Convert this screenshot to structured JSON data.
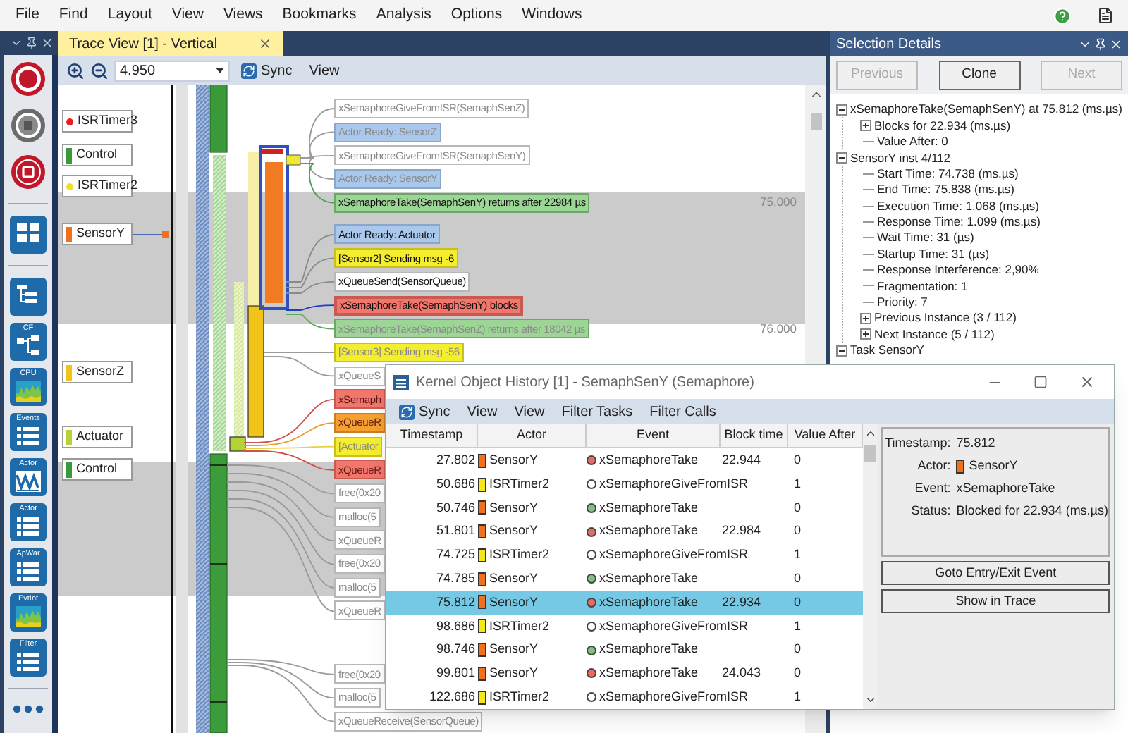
{
  "menu": [
    "File",
    "Find",
    "Layout",
    "View",
    "Views",
    "Bookmarks",
    "Analysis",
    "Options",
    "Windows"
  ],
  "tools": [
    {
      "kind": "record"
    },
    {
      "kind": "stop"
    },
    {
      "kind": "snapshot"
    },
    {
      "kind": "separator"
    },
    {
      "kind": "grid"
    },
    {
      "kind": "separator"
    },
    {
      "kind": "tree"
    },
    {
      "kind": "flow",
      "label": "CF"
    },
    {
      "kind": "chart",
      "label": "CPU"
    },
    {
      "kind": "list",
      "label": "Events"
    },
    {
      "kind": "wave",
      "label": "Actor"
    },
    {
      "kind": "list",
      "label": "Actor"
    },
    {
      "kind": "list",
      "label": "ApWar"
    },
    {
      "kind": "chart",
      "label": "EvtInt"
    },
    {
      "kind": "list",
      "label": "Filter"
    },
    {
      "kind": "separator"
    },
    {
      "kind": "more"
    }
  ],
  "trace_view": {
    "tab": "Trace View [1] - Vertical",
    "zoom": "4.950",
    "toolbar": [
      "Sync",
      "View"
    ],
    "actors": [
      {
        "name": "ISRTimer3",
        "kind": "dot",
        "color": "#e82020",
        "linked": false
      },
      {
        "name": "Control",
        "kind": "bar",
        "color": "#3a9a3a",
        "linked": false
      },
      {
        "name": "ISRTimer2",
        "kind": "dot",
        "color": "#f0e020",
        "linked": false
      },
      {
        "name": "SensorY",
        "kind": "bar",
        "color": "#f07020",
        "linked": true
      },
      {
        "name": "SensorZ",
        "kind": "bar",
        "color": "#f2c419",
        "linked": false
      },
      {
        "name": "Actuator",
        "kind": "bar",
        "color": "#b5d334",
        "linked": false
      },
      {
        "name": "Control",
        "kind": "bar",
        "color": "#3a9a3a",
        "linked": false
      }
    ],
    "events": [
      {
        "text": "xSemaphoreGiveFromISR(SemaphSenZ)",
        "kind": "plain",
        "dimmed": true,
        "selected": false
      },
      {
        "text": "Actor Ready: SensorZ",
        "kind": "ready",
        "dimmed": true,
        "selected": false
      },
      {
        "text": "xSemaphoreGiveFromISR(SemaphSenY)",
        "kind": "plain",
        "dimmed": true,
        "selected": false
      },
      {
        "text": "Actor Ready: SensorY",
        "kind": "ready",
        "dimmed": true,
        "selected": false
      },
      {
        "text": "xSemaphoreTake(SemaphSenY) returns after 22984 µs",
        "kind": "green",
        "dimmed": false,
        "selected": false,
        "mark": "75.000"
      },
      {
        "text": "Actor Ready: Actuator",
        "kind": "ready",
        "dimmed": false,
        "selected": false
      },
      {
        "text": "[Sensor2] Sending msg -6",
        "kind": "yellow",
        "dimmed": false,
        "selected": false
      },
      {
        "text": "xQueueSend(SensorQueue)",
        "kind": "plain",
        "dimmed": false,
        "selected": false
      },
      {
        "text": "xSemaphoreTake(SemaphSenY) blocks",
        "kind": "red",
        "dimmed": false,
        "selected": true
      },
      {
        "text": "xSemaphoreTake(SemaphSenZ) returns after 18042 µs",
        "kind": "green",
        "dimmed": true,
        "selected": false,
        "mark": "76.000"
      },
      {
        "text": "[Sensor3] Sending msg -56",
        "kind": "yellow",
        "dimmed": true,
        "selected": false
      },
      {
        "text": "xQueueS",
        "kind": "plain",
        "dimmed": true,
        "selected": false
      },
      {
        "text": "xSemaph",
        "kind": "red",
        "dimmed": true,
        "selected": false
      },
      {
        "text": "xQueueR",
        "kind": "orange",
        "dimmed": true,
        "selected": false
      },
      {
        "text": "[Actuator",
        "kind": "yellow",
        "dimmed": true,
        "selected": false
      },
      {
        "text": "xQueueR",
        "kind": "red",
        "dimmed": true,
        "selected": false
      },
      {
        "text": "free(0x20",
        "kind": "plain",
        "dimmed": true,
        "selected": false
      },
      {
        "text": "malloc(5",
        "kind": "plain",
        "dimmed": true,
        "selected": false
      },
      {
        "text": "xQueueR",
        "kind": "plain",
        "dimmed": true,
        "selected": false
      },
      {
        "text": "free(0x20",
        "kind": "plain",
        "dimmed": true,
        "selected": false
      },
      {
        "text": "malloc(5",
        "kind": "plain",
        "dimmed": true,
        "selected": false
      },
      {
        "text": "xQueueR",
        "kind": "plain",
        "dimmed": true,
        "selected": false
      },
      {
        "text": "free(0x20",
        "kind": "plain",
        "dimmed": true,
        "selected": false
      },
      {
        "text": "malloc(5",
        "kind": "plain",
        "dimmed": true,
        "selected": false
      },
      {
        "text": "xQueueReceive(SensorQueue)",
        "kind": "plain",
        "dimmed": true,
        "selected": false
      }
    ]
  },
  "selection_details": {
    "title": "Selection Details",
    "buttons": [
      {
        "label": "Previous",
        "disabled": true
      },
      {
        "label": "Clone",
        "disabled": false
      },
      {
        "label": "Next",
        "disabled": true
      }
    ],
    "tree": [
      {
        "text": "xSemaphoreTake(SemaphSenY) at 75.812 (ms.µs)",
        "expanded": true,
        "children": [
          {
            "text": "Blocks for 22.934 (ms.µs)",
            "expanded": false
          },
          {
            "text": "Value After: 0"
          }
        ]
      },
      {
        "text": "SensorY inst 4/112",
        "expanded": true,
        "children": [
          {
            "text": "Start Time: 74.738 (ms.µs)"
          },
          {
            "text": "End Time: 75.838 (ms.µs)"
          },
          {
            "text": "Execution Time: 1.068 (ms.µs)"
          },
          {
            "text": "Response Time: 1.099 (ms.µs)"
          },
          {
            "text": "Wait Time: 31 (µs)"
          },
          {
            "text": "Startup Time: 31 (µs)"
          },
          {
            "text": "Response Interference: 2,90%"
          },
          {
            "text": "Fragmentation: 1"
          },
          {
            "text": "Priority: 7"
          },
          {
            "text": "Previous Instance (3 / 112)",
            "expanded": false
          },
          {
            "text": "Next Instance (5 / 112)",
            "expanded": false
          }
        ]
      },
      {
        "text": "Task SensorY",
        "expanded": true
      }
    ]
  },
  "dialog": {
    "title": "Kernel Object History [1] - SemaphSenY (Semaphore)",
    "toolbar": [
      "Sync",
      "View",
      "View",
      "Filter Tasks",
      "Filter Calls"
    ],
    "columns": [
      "Timestamp",
      "Actor",
      "Event",
      "Block time",
      "Value After"
    ],
    "rows": [
      {
        "timestamp": "27.802",
        "actor": {
          "name": "SensorY",
          "color": "#f07020"
        },
        "event": {
          "name": "xSemaphoreTake",
          "color": "#e86a60"
        },
        "block_time": "22.944",
        "value_after": "0",
        "selected": false
      },
      {
        "timestamp": "50.686",
        "actor": {
          "name": "ISRTimer2",
          "color": "#f4e818"
        },
        "event": {
          "name": "xSemaphoreGiveFromISR",
          "color": "#ffffff"
        },
        "value_after": "1",
        "selected": false
      },
      {
        "timestamp": "50.746",
        "actor": {
          "name": "SensorY",
          "color": "#f07020"
        },
        "event": {
          "name": "xSemaphoreTake",
          "color": "#7cc47a"
        },
        "value_after": "0",
        "selected": false
      },
      {
        "timestamp": "51.801",
        "actor": {
          "name": "SensorY",
          "color": "#f07020"
        },
        "event": {
          "name": "xSemaphoreTake",
          "color": "#e86a60"
        },
        "block_time": "22.984",
        "value_after": "0",
        "selected": false
      },
      {
        "timestamp": "74.725",
        "actor": {
          "name": "ISRTimer2",
          "color": "#f4e818"
        },
        "event": {
          "name": "xSemaphoreGiveFromISR",
          "color": "#ffffff"
        },
        "value_after": "1",
        "selected": false
      },
      {
        "timestamp": "74.785",
        "actor": {
          "name": "SensorY",
          "color": "#f07020"
        },
        "event": {
          "name": "xSemaphoreTake",
          "color": "#7cc47a"
        },
        "value_after": "0",
        "selected": false
      },
      {
        "timestamp": "75.812",
        "actor": {
          "name": "SensorY",
          "color": "#f07020"
        },
        "event": {
          "name": "xSemaphoreTake",
          "color": "#e86a60"
        },
        "block_time": "22.934",
        "value_after": "0",
        "selected": true
      },
      {
        "timestamp": "98.686",
        "actor": {
          "name": "ISRTimer2",
          "color": "#f4e818"
        },
        "event": {
          "name": "xSemaphoreGiveFromISR",
          "color": "#ffffff"
        },
        "value_after": "1",
        "selected": false
      },
      {
        "timestamp": "98.746",
        "actor": {
          "name": "SensorY",
          "color": "#f07020"
        },
        "event": {
          "name": "xSemaphoreTake",
          "color": "#7cc47a"
        },
        "value_after": "0",
        "selected": false
      },
      {
        "timestamp": "99.801",
        "actor": {
          "name": "SensorY",
          "color": "#f07020"
        },
        "event": {
          "name": "xSemaphoreTake",
          "color": "#e86a60"
        },
        "block_time": "24.043",
        "value_after": "0",
        "selected": false
      },
      {
        "timestamp": "122.686",
        "actor": {
          "name": "ISRTimer2",
          "color": "#f4e818"
        },
        "event": {
          "name": "xSemaphoreGiveFromISR",
          "color": "#ffffff"
        },
        "value_after": "1",
        "selected": false
      }
    ],
    "details": [
      {
        "label": "Timestamp:",
        "value": "75.812"
      },
      {
        "label": "Actor:",
        "value": "SensorY",
        "color": "#f07020"
      },
      {
        "label": "Event:",
        "value": "xSemaphoreTake"
      },
      {
        "label": "Status:",
        "value": "Blocked for 22.934 (ms.µs)"
      }
    ],
    "buttons": [
      "Goto Entry/Exit Event",
      "Show in Trace"
    ]
  }
}
